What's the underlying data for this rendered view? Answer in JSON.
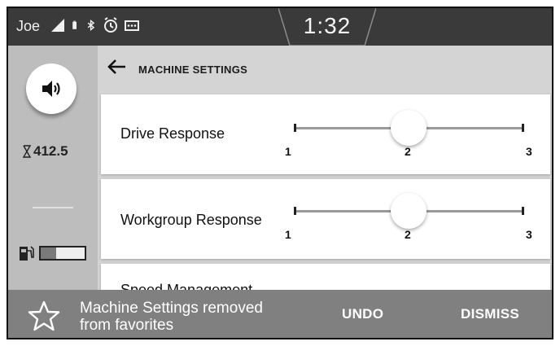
{
  "status_bar": {
    "user": "Joe",
    "time": "1:32",
    "icons": [
      "signal-icon",
      "battery-icon",
      "bluetooth-icon",
      "alarm-icon",
      "message-icon"
    ]
  },
  "rail": {
    "volume_icon": "speaker-icon",
    "hours_icon": "hourglass-icon",
    "hours_value": "412.5",
    "fuel_icon": "fuel-pump-icon",
    "fuel_level": 0.35
  },
  "header": {
    "back_icon": "back-arrow-icon",
    "title": "MACHINE SETTINGS"
  },
  "settings": [
    {
      "label": "Drive Response",
      "min": "1",
      "mid": "2",
      "max": "3",
      "value": 2
    },
    {
      "label": "Workgroup Response",
      "min": "1",
      "mid": "2",
      "max": "3",
      "value": 2
    },
    {
      "label": "Speed Management"
    }
  ],
  "snackbar": {
    "icon": "star-outline-icon",
    "message_line1": "Machine Settings removed",
    "message_line2": "from favorites",
    "undo_label": "UNDO",
    "dismiss_label": "DISMISS"
  },
  "colors": {
    "status_bar_bg": "#3a3a3a",
    "rail_bg": "#bdbdbd",
    "content_bg": "#d4d4d4",
    "snackbar_bg": "#808080"
  }
}
